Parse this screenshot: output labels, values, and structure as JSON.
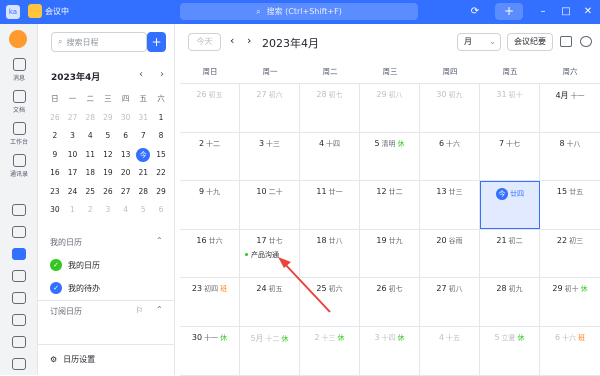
{
  "titlebar": {
    "app_badge": "ka",
    "meeting_label": "会议中",
    "search_placeholder": "搜索 (Ctrl+Shift+F)",
    "plus": "+",
    "history_icon": "⟳",
    "minimize": "–",
    "maximize": "□",
    "close": "✕"
  },
  "nav": {
    "items": [
      {
        "label": "消息"
      },
      {
        "label": "文档"
      },
      {
        "label": "工作台"
      },
      {
        "label": "通讯录"
      }
    ]
  },
  "sidebar": {
    "search_placeholder": "搜索日程",
    "new_button": "+",
    "mini_month": "2023年4月",
    "prev": "‹",
    "next": "›",
    "weekdays": [
      "日",
      "一",
      "二",
      "三",
      "四",
      "五",
      "六"
    ],
    "weeks": [
      [
        {
          "d": "26",
          "o": true
        },
        {
          "d": "27",
          "o": true
        },
        {
          "d": "28",
          "o": true
        },
        {
          "d": "29",
          "o": true
        },
        {
          "d": "30",
          "o": true
        },
        {
          "d": "31",
          "o": true
        },
        {
          "d": "1"
        }
      ],
      [
        {
          "d": "2"
        },
        {
          "d": "3"
        },
        {
          "d": "4"
        },
        {
          "d": "5"
        },
        {
          "d": "6"
        },
        {
          "d": "7"
        },
        {
          "d": "8"
        }
      ],
      [
        {
          "d": "9"
        },
        {
          "d": "10"
        },
        {
          "d": "11"
        },
        {
          "d": "12"
        },
        {
          "d": "13"
        },
        {
          "d": "今",
          "t": true
        },
        {
          "d": "15"
        }
      ],
      [
        {
          "d": "16"
        },
        {
          "d": "17"
        },
        {
          "d": "18"
        },
        {
          "d": "19"
        },
        {
          "d": "20"
        },
        {
          "d": "21"
        },
        {
          "d": "22"
        }
      ],
      [
        {
          "d": "23"
        },
        {
          "d": "24"
        },
        {
          "d": "25"
        },
        {
          "d": "26"
        },
        {
          "d": "27"
        },
        {
          "d": "28"
        },
        {
          "d": "29"
        }
      ],
      [
        {
          "d": "30"
        },
        {
          "d": "1",
          "o": true
        },
        {
          "d": "2",
          "o": true
        },
        {
          "d": "3",
          "o": true
        },
        {
          "d": "4",
          "o": true
        },
        {
          "d": "5",
          "o": true
        },
        {
          "d": "6",
          "o": true
        }
      ]
    ],
    "my_calendars": "我的日历",
    "calendars": [
      {
        "label": "我的日历",
        "color": "#34c724"
      },
      {
        "label": "我的待办",
        "color": "#3370ff"
      }
    ],
    "subscribed": "订阅日历",
    "settings": "日历设置"
  },
  "toolbar": {
    "today": "今天",
    "prev": "‹",
    "next": "›",
    "month_title": "2023年4月",
    "view": "月",
    "view_caret": "⌄",
    "minutes": "会议纪要"
  },
  "calendar": {
    "weekdays": [
      "周日",
      "周一",
      "周二",
      "周三",
      "周四",
      "周五",
      "周六"
    ],
    "weeks": [
      [
        {
          "d": "26",
          "l": "初五",
          "o": true
        },
        {
          "d": "27",
          "l": "初六",
          "o": true
        },
        {
          "d": "28",
          "l": "初七",
          "o": true
        },
        {
          "d": "29",
          "l": "初八",
          "o": true
        },
        {
          "d": "30",
          "l": "初九",
          "o": true
        },
        {
          "d": "31",
          "l": "初十",
          "o": true
        },
        {
          "d": "4月",
          "l": "十一"
        }
      ],
      [
        {
          "d": "2",
          "l": "十二"
        },
        {
          "d": "3",
          "l": "十三"
        },
        {
          "d": "4",
          "l": "十四"
        },
        {
          "d": "5",
          "l": "清明",
          "tag": "休",
          "tc": "#34c724"
        },
        {
          "d": "6",
          "l": "十六"
        },
        {
          "d": "7",
          "l": "十七"
        },
        {
          "d": "8",
          "l": "十八"
        }
      ],
      [
        {
          "d": "9",
          "l": "十九"
        },
        {
          "d": "10",
          "l": "二十"
        },
        {
          "d": "11",
          "l": "廿一"
        },
        {
          "d": "12",
          "l": "廿二"
        },
        {
          "d": "13",
          "l": "廿三"
        },
        {
          "d": "今",
          "l": "廿四",
          "t": true
        },
        {
          "d": "15",
          "l": "廿五"
        }
      ],
      [
        {
          "d": "16",
          "l": "廿六"
        },
        {
          "d": "17",
          "l": "廿七",
          "ev": "产品沟通"
        },
        {
          "d": "18",
          "l": "廿八"
        },
        {
          "d": "19",
          "l": "廿九"
        },
        {
          "d": "20",
          "l": "谷雨"
        },
        {
          "d": "21",
          "l": "初二"
        },
        {
          "d": "22",
          "l": "初三"
        }
      ],
      [
        {
          "d": "23",
          "l": "初四",
          "tag": "班",
          "tc": "#ff7d00"
        },
        {
          "d": "24",
          "l": "初五"
        },
        {
          "d": "25",
          "l": "初六"
        },
        {
          "d": "26",
          "l": "初七"
        },
        {
          "d": "27",
          "l": "初八"
        },
        {
          "d": "28",
          "l": "初九"
        },
        {
          "d": "29",
          "l": "初十",
          "tag": "休",
          "tc": "#34c724"
        }
      ],
      [
        {
          "d": "30",
          "l": "十一",
          "tag": "休",
          "tc": "#34c724"
        },
        {
          "d": "5月",
          "l": "十二",
          "tag": "休",
          "tc": "#34c724",
          "o": true
        },
        {
          "d": "2",
          "l": "十三",
          "tag": "休",
          "tc": "#34c724",
          "o": true
        },
        {
          "d": "3",
          "l": "十四",
          "tag": "休",
          "tc": "#34c724",
          "o": true
        },
        {
          "d": "4",
          "l": "十五",
          "o": true
        },
        {
          "d": "5",
          "l": "立夏",
          "tag": "休",
          "tc": "#34c724",
          "o": true
        },
        {
          "d": "6",
          "l": "十六",
          "tag": "班",
          "tc": "#ff7d00",
          "o": true
        }
      ]
    ]
  },
  "colors": {
    "accent": "#3370ff",
    "rest": "#34c724",
    "work": "#ff7d00"
  }
}
